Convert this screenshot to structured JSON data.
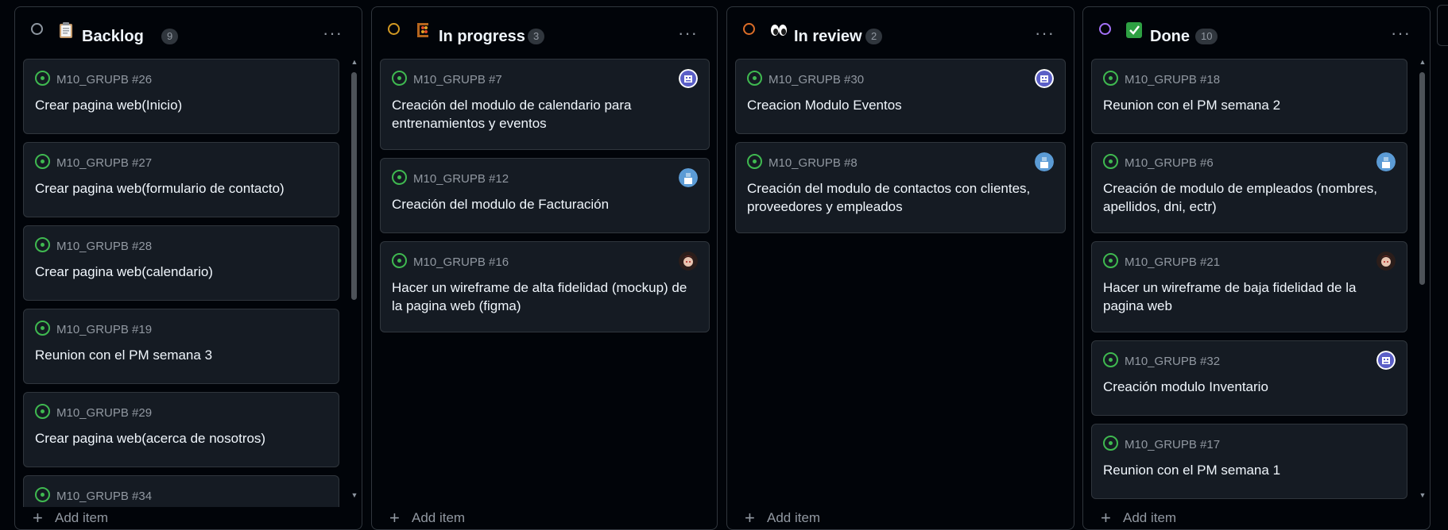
{
  "columns": [
    {
      "title": "Backlog",
      "count": "9",
      "status_color": "#8d96a0",
      "emoji": "clipboard-icon",
      "cards": [
        {
          "ref": "M10_GRUPB #26",
          "title": "Crear pagina web(Inicio)",
          "avatar": ""
        },
        {
          "ref": "M10_GRUPB #27",
          "title": "Crear pagina web(formulario de contacto)",
          "avatar": ""
        },
        {
          "ref": "M10_GRUPB #28",
          "title": "Crear pagina web(calendario)",
          "avatar": ""
        },
        {
          "ref": "M10_GRUPB #19",
          "title": "Reunion con el PM semana 3",
          "avatar": ""
        },
        {
          "ref": "M10_GRUPB #29",
          "title": "Crear pagina web(acerca de nosotros)",
          "avatar": ""
        },
        {
          "ref": "M10_GRUPB #34",
          "title": "",
          "avatar": ""
        }
      ],
      "add_item": "Add item"
    },
    {
      "title": "In progress",
      "count": "3",
      "status_color": "#d29922",
      "emoji": "abacus-icon",
      "cards": [
        {
          "ref": "M10_GRUPB #7",
          "title": "Creación del modulo de calendario para entrenamientos y eventos",
          "avatar": "robot-avatar"
        },
        {
          "ref": "M10_GRUPB #12",
          "title": "Creación del modulo de Facturación",
          "avatar": "blue-avatar"
        },
        {
          "ref": "M10_GRUPB #16",
          "title": "Hacer un wireframe de alta fidelidad (mockup) de la pagina web (figma)",
          "avatar": "anime-avatar"
        }
      ],
      "add_item": "Add item"
    },
    {
      "title": "In review",
      "count": "2",
      "status_color": "#db6d28",
      "emoji": "eyes-icon",
      "cards": [
        {
          "ref": "M10_GRUPB #30",
          "title": "Creacion Modulo Eventos",
          "avatar": "robot-avatar"
        },
        {
          "ref": "M10_GRUPB #8",
          "title": "Creación del modulo de contactos con clientes, proveedores y empleados",
          "avatar": "blue-avatar"
        }
      ],
      "add_item": "Add item"
    },
    {
      "title": "Done",
      "count": "10",
      "status_color": "#a371f7",
      "emoji": "check-mark-icon",
      "cards": [
        {
          "ref": "M10_GRUPB #18",
          "title": "Reunion con el PM semana 2",
          "avatar": ""
        },
        {
          "ref": "M10_GRUPB #6",
          "title": "Creación de modulo de empleados (nombres, apellidos, dni, ectr)",
          "avatar": "blue-avatar"
        },
        {
          "ref": "M10_GRUPB #21",
          "title": "Hacer un wireframe de baja fidelidad de la pagina web",
          "avatar": "anime-avatar"
        },
        {
          "ref": "M10_GRUPB #32",
          "title": "Creación modulo Inventario",
          "avatar": "robot-avatar"
        },
        {
          "ref": "M10_GRUPB #17",
          "title": "Reunion con el PM semana 1",
          "avatar": ""
        }
      ],
      "add_item": "Add item"
    }
  ],
  "colors": {
    "background": "#010409",
    "card": "#151b23",
    "border": "#30363d",
    "issue_open": "#3fb950"
  }
}
